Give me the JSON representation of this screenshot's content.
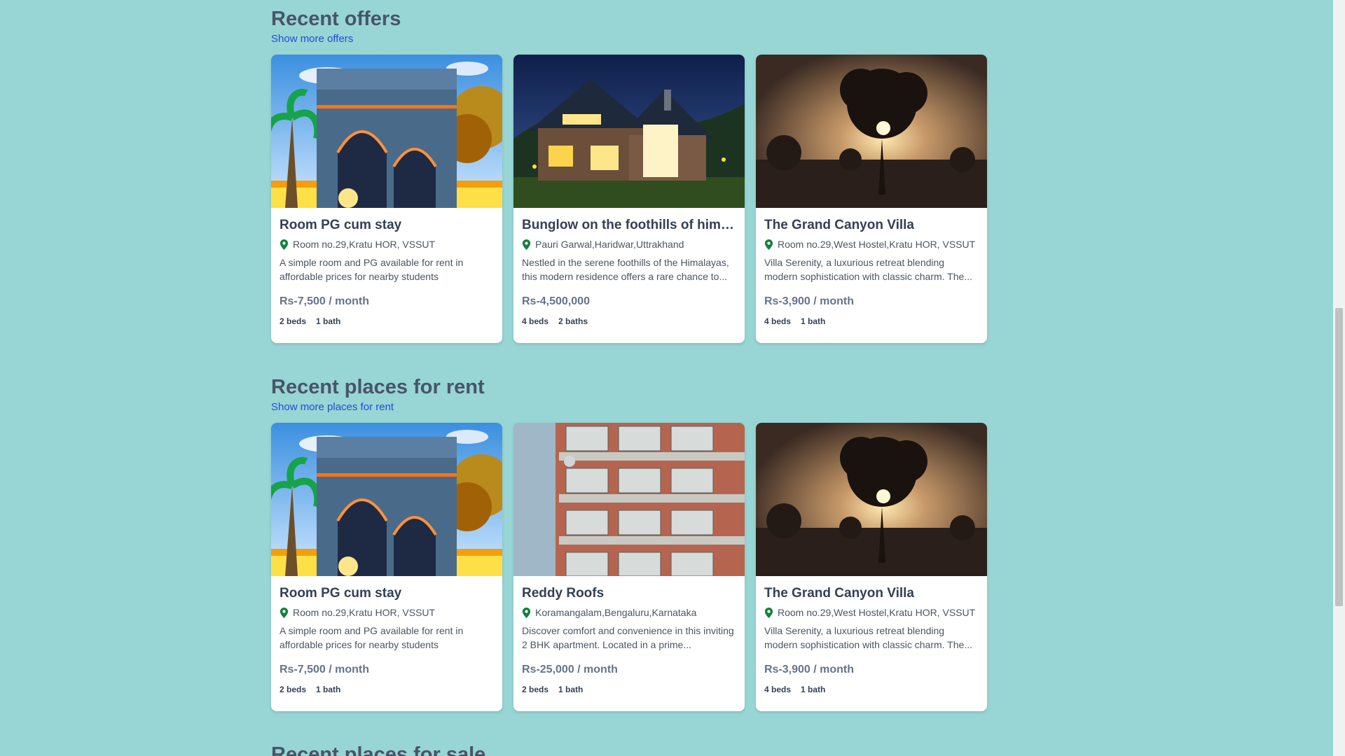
{
  "sections": [
    {
      "title": "Recent offers",
      "link": "Show more offers",
      "cards": [
        {
          "image": "india-gate-illustration",
          "title": "Room PG cum stay",
          "address": "Room no.29,Kratu HOR, VSSUT",
          "description": "A simple room and PG available for rent in affordable prices for nearby students",
          "price": "Rs-7,500 / month",
          "beds": "2 beds",
          "baths": "1 bath"
        },
        {
          "image": "mountain-bungalow-night",
          "title": "Bunglow on the foothills of himalay...",
          "address": "Pauri Garwal,Haridwar,Uttrakhand",
          "description": "Nestled in the serene foothills of the Himalayas, this modern residence offers a rare chance to...",
          "price": "Rs-4,500,000",
          "beds": "4 beds",
          "baths": "2 baths"
        },
        {
          "image": "sunset-tree-field",
          "title": "The Grand Canyon Villa",
          "address": "Room no.29,West Hostel,Kratu HOR, VSSUT",
          "description": "Villa Serenity, a luxurious retreat blending modern sophistication with classic charm. The...",
          "price": "Rs-3,900 / month",
          "beds": "4 beds",
          "baths": "1 bath"
        }
      ]
    },
    {
      "title": "Recent places for rent",
      "link": "Show more places for rent",
      "cards": [
        {
          "image": "india-gate-illustration",
          "title": "Room PG cum stay",
          "address": "Room no.29,Kratu HOR, VSSUT",
          "description": "A simple room and PG available for rent in affordable prices for nearby students",
          "price": "Rs-7,500 / month",
          "beds": "2 beds",
          "baths": "1 bath"
        },
        {
          "image": "apartment-building",
          "title": "Reddy Roofs",
          "address": "Koramangalam,Bengaluru,Karnataka",
          "description": "Discover comfort and convenience in this inviting 2 BHK apartment. Located in a prime...",
          "price": "Rs-25,000 / month",
          "beds": "2 beds",
          "baths": "1 bath"
        },
        {
          "image": "sunset-tree-field",
          "title": "The Grand Canyon Villa",
          "address": "Room no.29,West Hostel,Kratu HOR, VSSUT",
          "description": "Villa Serenity, a luxurious retreat blending modern sophistication with classic charm. The...",
          "price": "Rs-3,900 / month",
          "beds": "4 beds",
          "baths": "1 bath"
        }
      ]
    },
    {
      "title": "Recent places for sale"
    }
  ],
  "colors": {
    "background": "#98d5d5",
    "link": "#1d4ed8",
    "pin": "#15803d"
  }
}
